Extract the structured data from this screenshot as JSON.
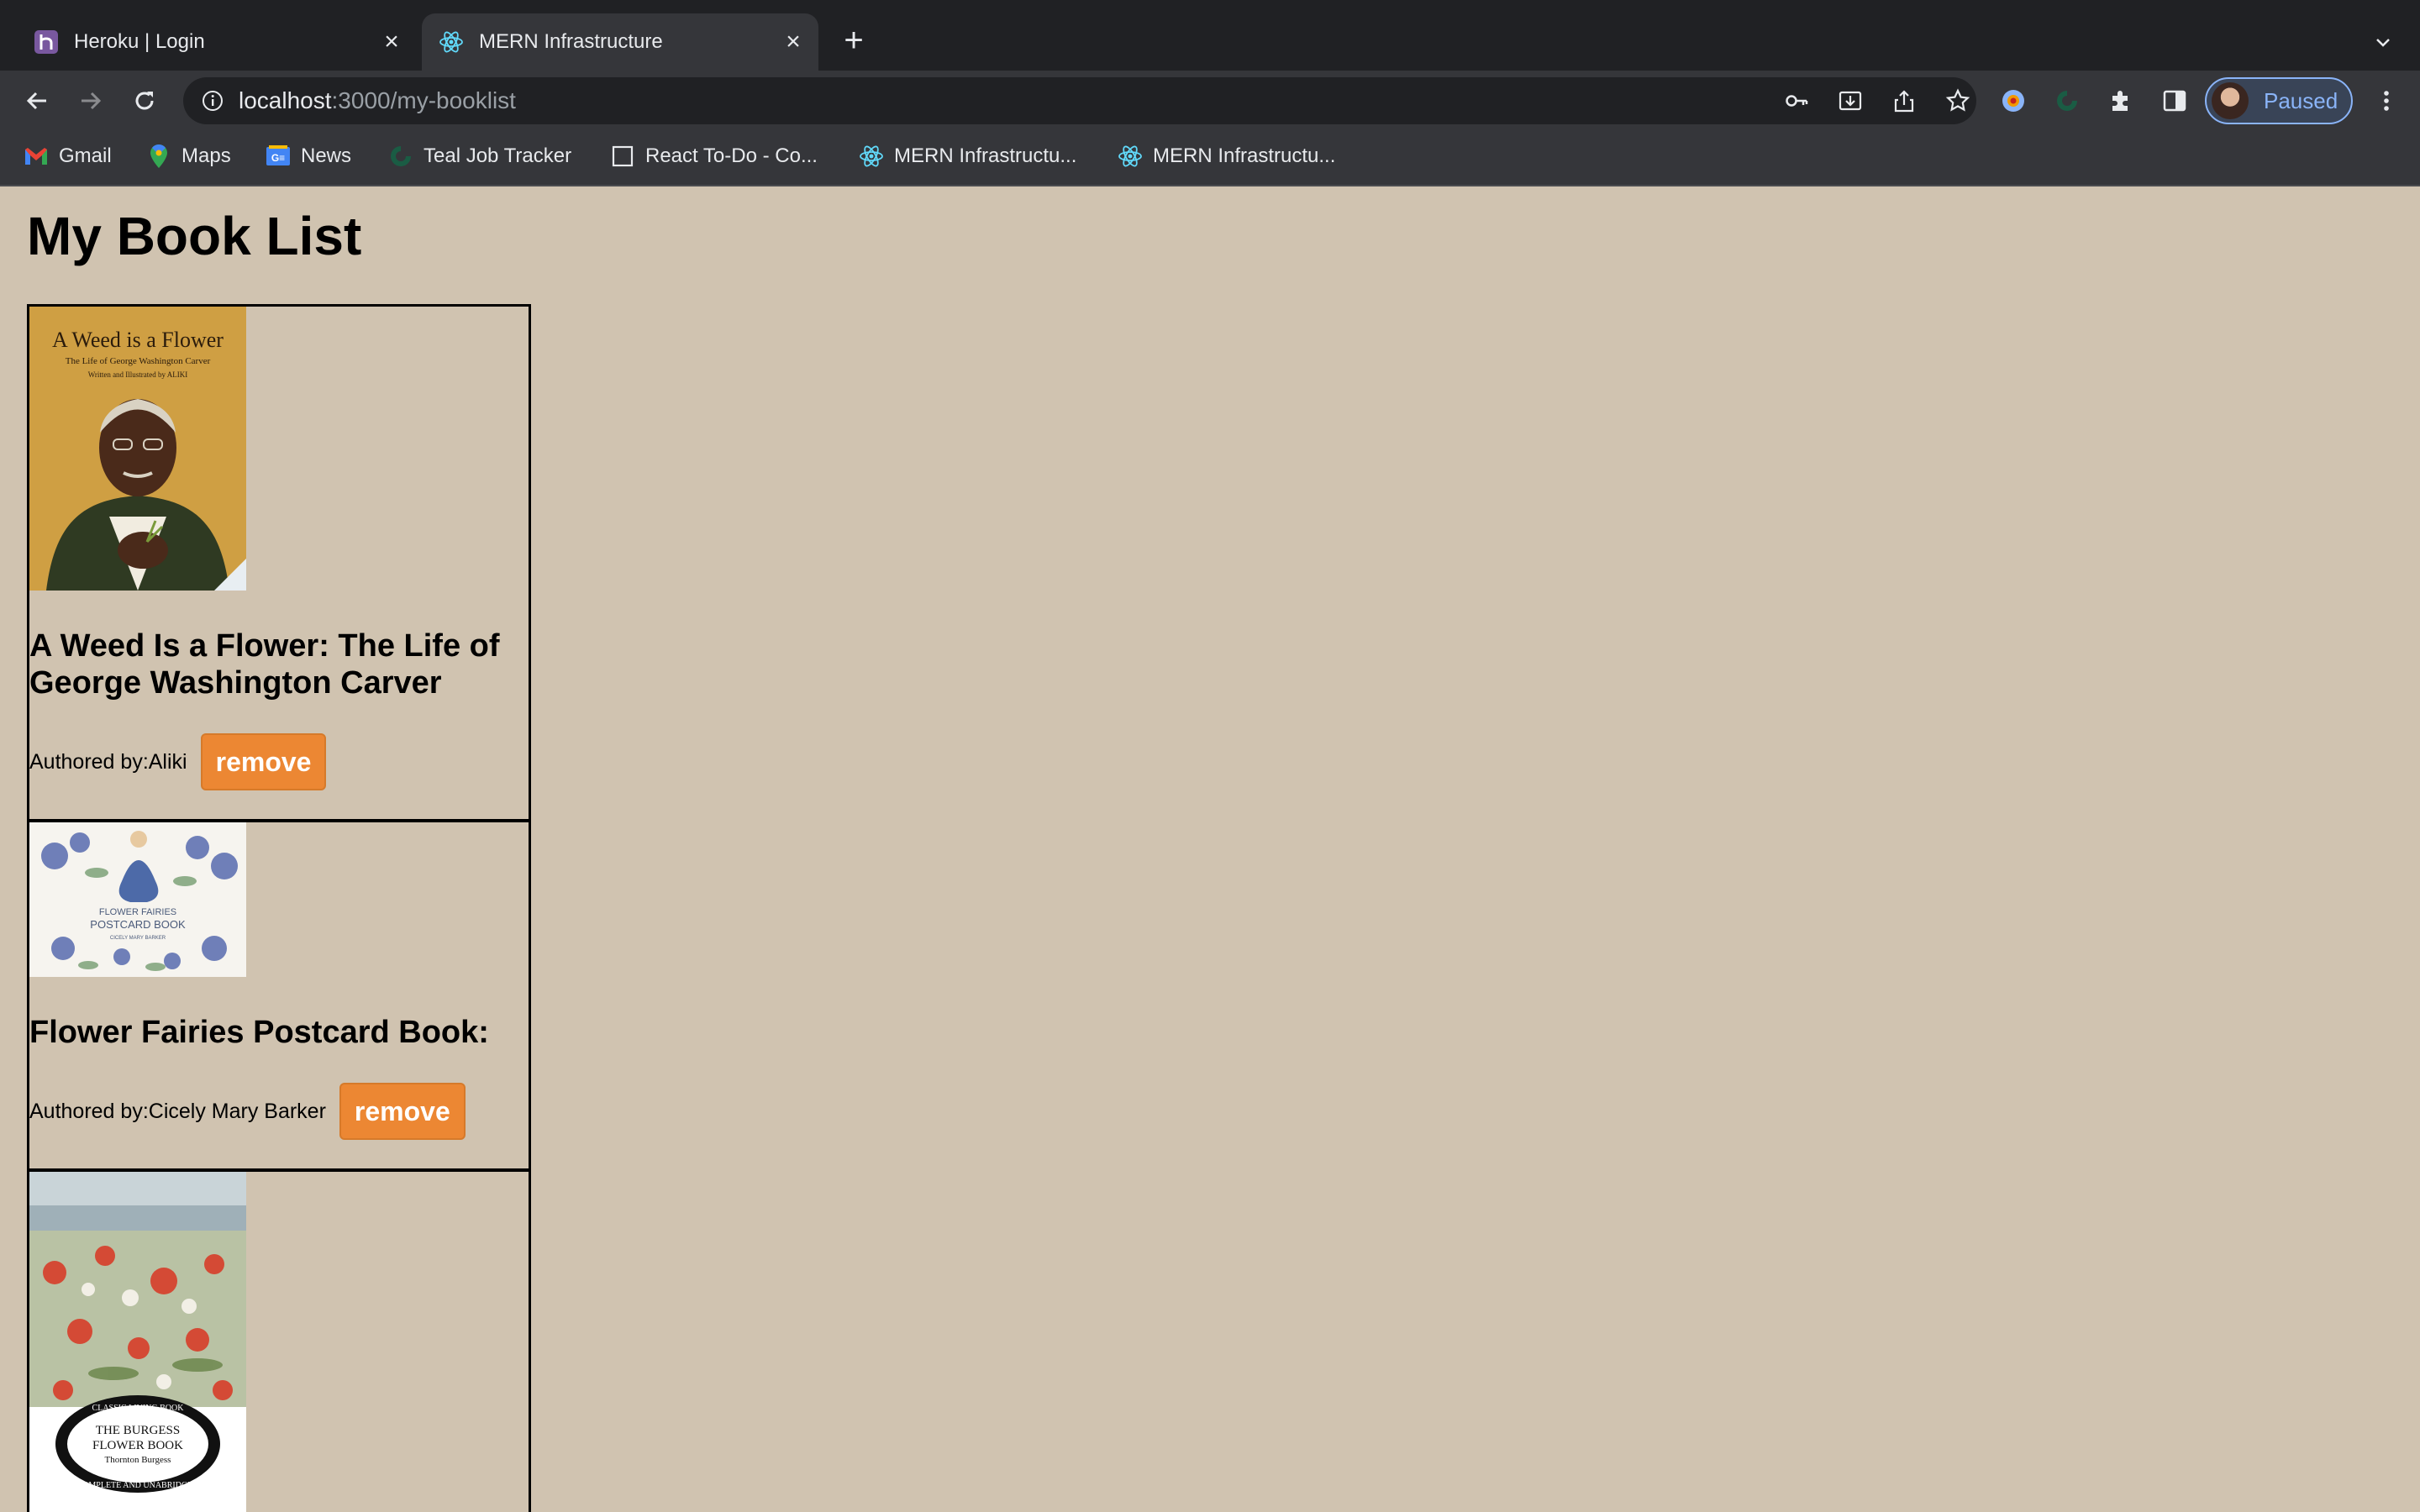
{
  "browser": {
    "tabs": [
      {
        "title": "Heroku | Login",
        "favicon": "heroku-icon",
        "active": false
      },
      {
        "title": "MERN Infrastructure",
        "favicon": "react-icon",
        "active": true
      }
    ],
    "url_host": "localhost",
    "url_path": ":3000/my-booklist",
    "profile_label": "Paused",
    "bookmarks": [
      {
        "label": "Gmail",
        "icon": "gmail-icon"
      },
      {
        "label": "Maps",
        "icon": "maps-icon"
      },
      {
        "label": "News",
        "icon": "news-icon"
      },
      {
        "label": "Teal Job Tracker",
        "icon": "teal-icon"
      },
      {
        "label": "React To-Do - Co...",
        "icon": "page-icon"
      },
      {
        "label": "MERN Infrastructu...",
        "icon": "react-icon"
      },
      {
        "label": "MERN Infrastructu...",
        "icon": "react-icon"
      }
    ]
  },
  "page": {
    "title": "My Book List",
    "books": [
      {
        "title": "A Weed Is a Flower: The Life of George Washington Carver",
        "author": "Authored by:Aliki",
        "remove_label": "remove",
        "cover": {
          "title": "A Weed is a Flower",
          "subtitle": "The Life of George Washington Carver",
          "byline": "Written and Illustrated by ALIKI"
        }
      },
      {
        "title": "Flower Fairies Postcard Book:",
        "author": "Authored by:Cicely Mary Barker",
        "remove_label": "remove",
        "cover": {
          "line1": "FLOWER FAIRIES",
          "line2": "POSTCARD BOOK",
          "line3": "CICELY MARY BARKER"
        }
      },
      {
        "cover": {
          "arc_top": "CLASSIC LIVING BOOK",
          "title1": "THE BURGESS",
          "title2": "FLOWER BOOK",
          "author": "Thornton Burgess",
          "arc_bottom": "COMPLETE AND UNABRIDGED"
        }
      }
    ]
  }
}
